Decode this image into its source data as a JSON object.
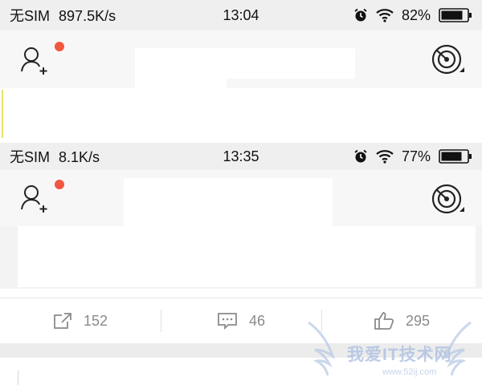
{
  "screen1": {
    "status": {
      "carrier": "无SIM",
      "speed": "897.5K/s",
      "time": "13:04",
      "battery": "82%"
    }
  },
  "screen2": {
    "status": {
      "carrier": "无SIM",
      "speed": "8.1K/s",
      "time": "13:35",
      "battery": "77%"
    }
  },
  "actions": {
    "share_count": "152",
    "comment_count": "46",
    "like_count": "295"
  },
  "watermark": {
    "text": "我爱IT技术网",
    "url": "www.52ij.com"
  },
  "icons": [
    "alarm-icon",
    "wifi-icon",
    "battery-icon",
    "add-friend-icon",
    "radar-icon",
    "share-icon",
    "comment-icon",
    "like-icon"
  ],
  "colors": {
    "notification_dot": "#f2573f",
    "icon_gray": "#8a8a8a",
    "status_bg": "#efefef"
  }
}
